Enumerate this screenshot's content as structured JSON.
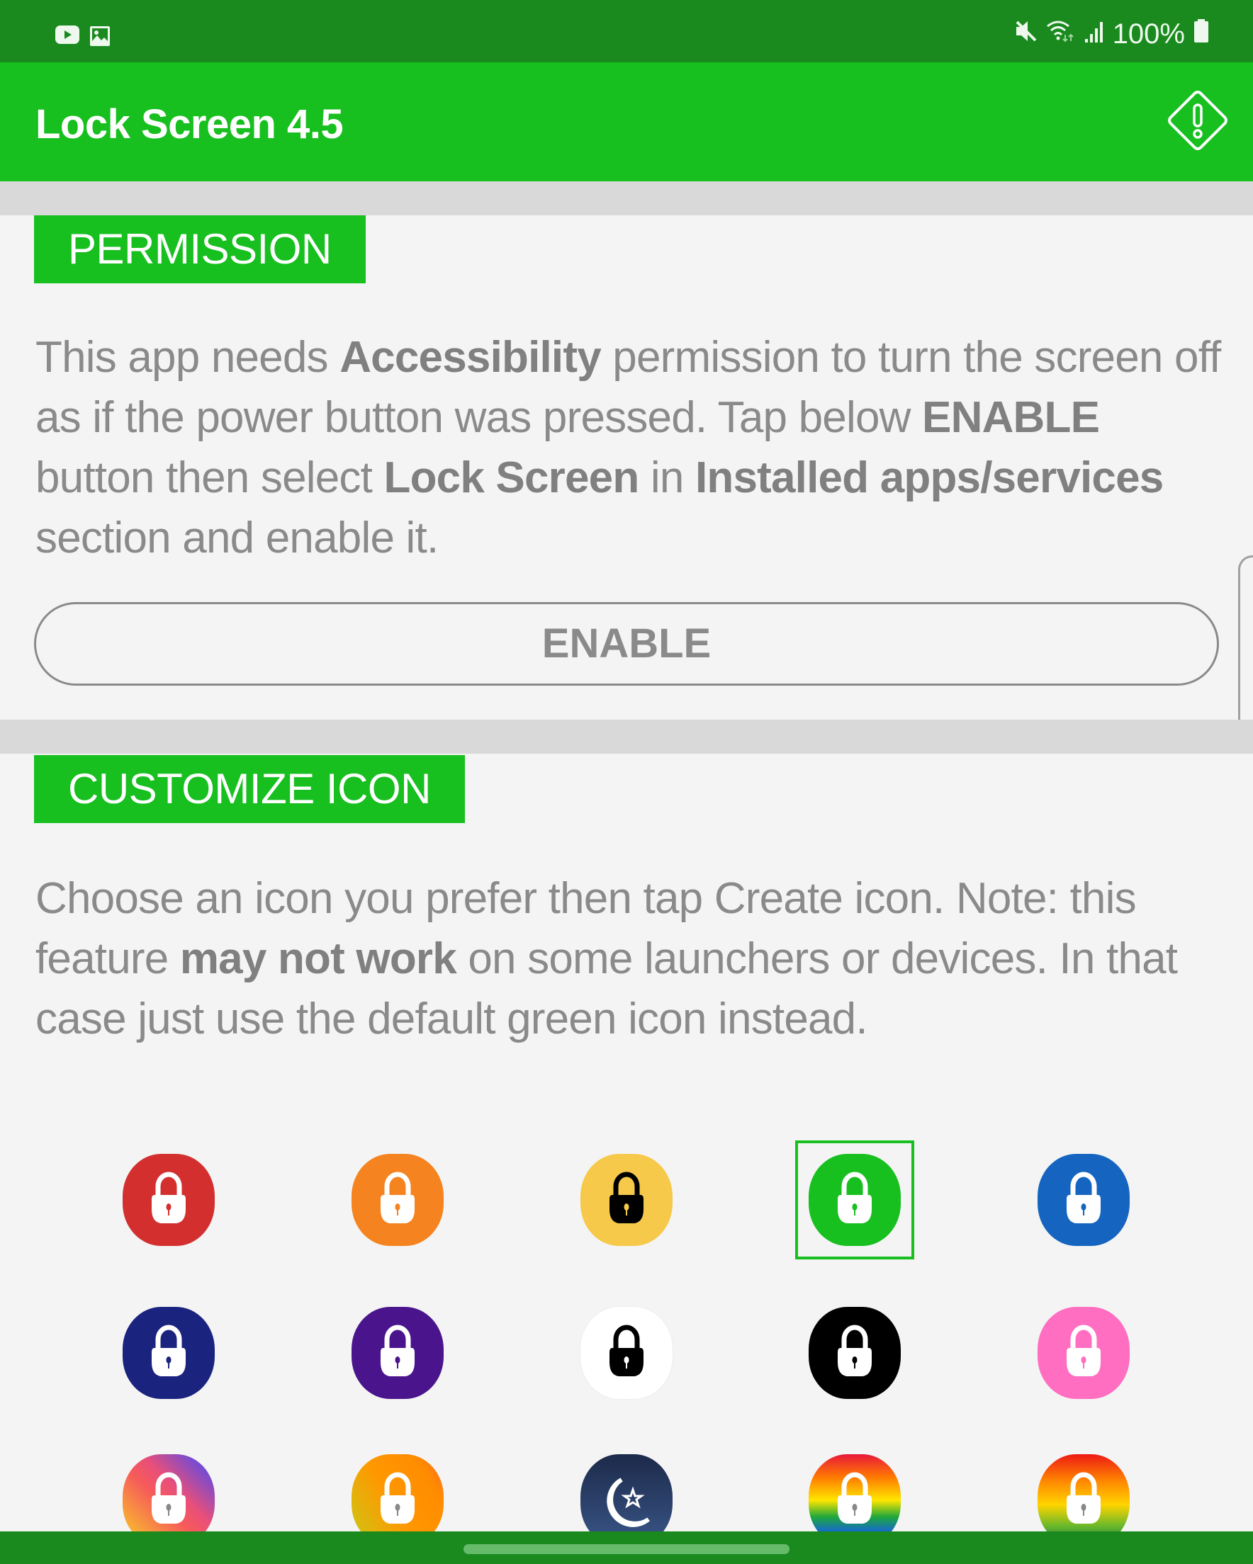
{
  "status_bar": {
    "left_icons": [
      "youtube-icon",
      "gallery-icon"
    ],
    "right_icons": [
      "mute-icon",
      "wifi-icon",
      "signal-icon",
      "battery-icon"
    ],
    "battery": "100%"
  },
  "app_bar": {
    "title": "Lock Screen 4.5",
    "action_icon": "warning-diamond-icon"
  },
  "permission": {
    "label": "PERMISSION",
    "text_parts": [
      {
        "t": "This app needs ",
        "b": false
      },
      {
        "t": "Accessibility",
        "b": true
      },
      {
        "t": " permission to turn the screen off as if the power button was pressed. Tap below ",
        "b": false
      },
      {
        "t": "ENABLE",
        "b": true
      },
      {
        "t": " button then select ",
        "b": false
      },
      {
        "t": "Lock Screen",
        "b": true
      },
      {
        "t": " in ",
        "b": false
      },
      {
        "t": "Installed apps/services",
        "b": true
      },
      {
        "t": " section and enable it.",
        "b": false
      }
    ],
    "button_label": "ENABLE"
  },
  "customize": {
    "label": "CUSTOMIZE ICON",
    "text_parts": [
      {
        "t": "Choose an icon you prefer then tap Create icon. Note: this feature ",
        "b": false
      },
      {
        "t": "may not work",
        "b": true
      },
      {
        "t": " on some launchers or devices. In that case just use the default green icon instead.",
        "b": false
      }
    ],
    "selected_index": 3,
    "icons": [
      {
        "name": "red",
        "bg": "#d32f2f",
        "lock": "#ffffff",
        "glyph": "lock"
      },
      {
        "name": "orange",
        "bg": "#f5831f",
        "lock": "#ffffff",
        "glyph": "lock"
      },
      {
        "name": "yellow",
        "bg": "#f6c94a",
        "lock": "#000000",
        "glyph": "lock"
      },
      {
        "name": "green",
        "bg": "#17bf1f",
        "lock": "#ffffff",
        "glyph": "lock"
      },
      {
        "name": "blue",
        "bg": "#1565c0",
        "lock": "#ffffff",
        "glyph": "lock"
      },
      {
        "name": "navy",
        "bg": "#1a237e",
        "lock": "#ffffff",
        "glyph": "lock"
      },
      {
        "name": "purple",
        "bg": "#4a148c",
        "lock": "#ffffff",
        "glyph": "lock"
      },
      {
        "name": "white",
        "bg": "#ffffff",
        "lock": "#000000",
        "glyph": "lock"
      },
      {
        "name": "black",
        "bg": "#000000",
        "lock": "#ffffff",
        "glyph": "lock"
      },
      {
        "name": "pink",
        "bg": "#ff6ec0",
        "lock": "#ffffff",
        "glyph": "lock"
      },
      {
        "name": "instagram-gradient",
        "bg": "linear-gradient(45deg,#f9d423 0%,#f65a5a 45%,#e94f7a 60%,#3949ff 100%)",
        "lock": "#ffffff",
        "glyph": "lock"
      },
      {
        "name": "sunset-gradient",
        "bg": "linear-gradient(60deg,#c9c916 0%,#ff9800 45%,#ff8c00 80%,#ff6a2a 100%)",
        "lock": "#ffffff",
        "glyph": "lock"
      },
      {
        "name": "night-sky",
        "bg": "linear-gradient(180deg,#1c2a4a 0%,#3a5688 100%)",
        "lock": "#ffffff",
        "glyph": "moon"
      },
      {
        "name": "rainbow-paint",
        "bg": "linear-gradient(180deg,#e8193a 0%,#ff7a00 25%,#ffe600 50%,#1fa83a 68%,#1565d8 85%,#0d1a5a 100%)",
        "lock": "#ffffff",
        "glyph": "lock"
      },
      {
        "name": "rainbow",
        "bg": "linear-gradient(180deg,#ee1a14 0%,#ff8a00 30%,#ffd400 55%,#6ab82a 78%,#0a6a4a 100%)",
        "lock": "#ffffff",
        "glyph": "lock"
      }
    ]
  },
  "colors": {
    "status_bar": "#1a8a1f",
    "accent": "#17bf1f",
    "body_text": "#8a8a8a",
    "divider": "#d9d9d9",
    "background": "#f4f4f4"
  }
}
